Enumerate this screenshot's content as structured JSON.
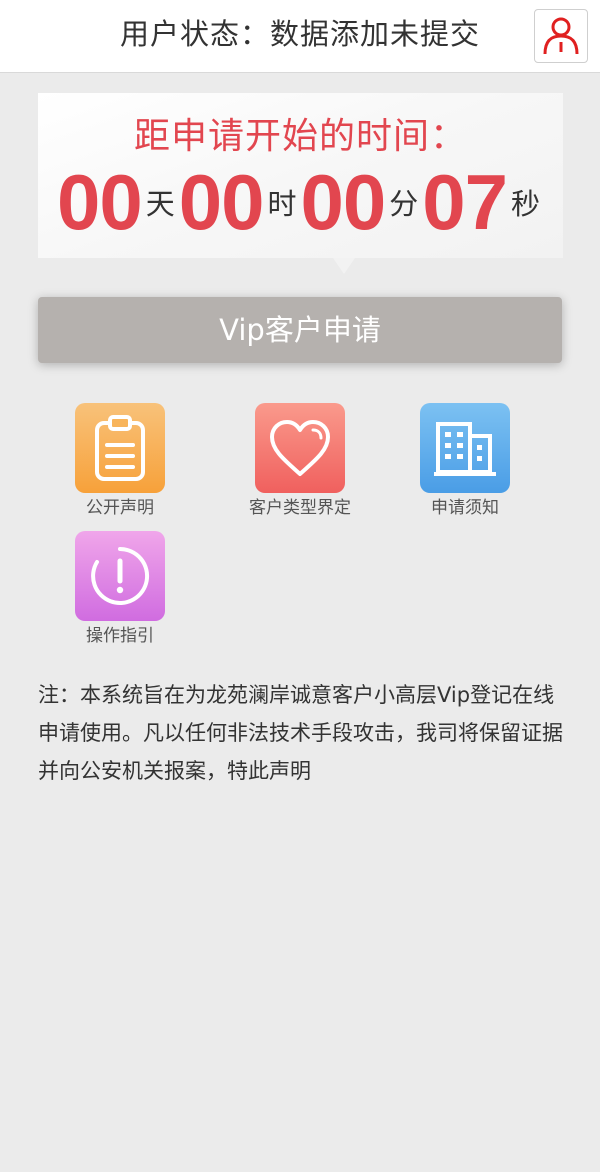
{
  "header": {
    "title": "用户状态：数据添加未提交",
    "user_icon": "person-icon"
  },
  "countdown": {
    "title": "距申请开始的时间：",
    "days": "00",
    "days_unit": "天",
    "hours": "00",
    "hours_unit": "时",
    "minutes": "00",
    "minutes_unit": "分",
    "seconds": "07",
    "seconds_unit": "秒"
  },
  "vip_button": {
    "label": "Vip客户申请"
  },
  "tiles": [
    {
      "label": "公开声明",
      "icon": "clipboard-icon",
      "color_start": "#f8c27a",
      "color_end": "#f7a13a"
    },
    {
      "label": "客户类型界定",
      "icon": "heart-icon",
      "color_start": "#fa9a8c",
      "color_end": "#f0605e"
    },
    {
      "label": "申请须知",
      "icon": "building-icon",
      "color_start": "#7cc1f2",
      "color_end": "#4a9de6"
    },
    {
      "label": "操作指引",
      "icon": "alert-circle-icon",
      "color_start": "#f0a6ea",
      "color_end": "#d06ce0"
    }
  ],
  "note": {
    "text": "注：本系统旨在为龙苑澜岸诚意客户小高层Vip登记在线申请使用。凡以任何非法技术手段攻击，我司将保留证据并向公安机关报案，特此声明"
  },
  "colors": {
    "accent": "#e2464f",
    "background": "#ebebeb",
    "button": "#b5b1ae"
  }
}
